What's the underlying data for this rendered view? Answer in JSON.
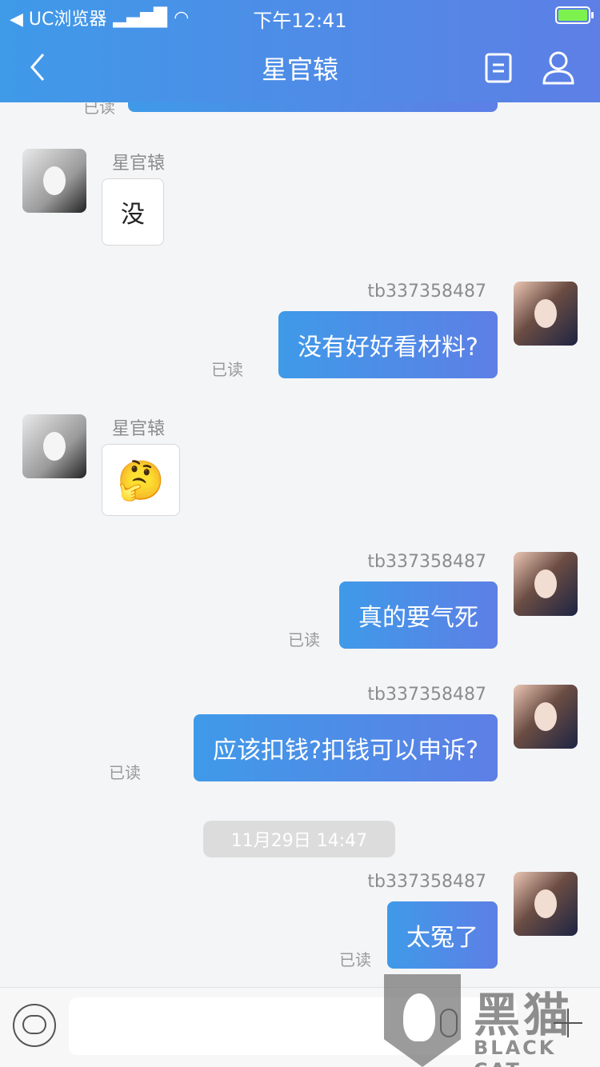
{
  "status_bar": {
    "back_app": "◀ UC浏览器",
    "time": "下午12:41"
  },
  "header": {
    "title": "星官辕"
  },
  "messages": {
    "top_read": "已读",
    "m1": {
      "sender": "星官辕",
      "text": "没"
    },
    "m2": {
      "sender": "tb337358487",
      "text": "没有好好看材料?",
      "read": "已读"
    },
    "m3": {
      "sender": "星官辕",
      "emoji": "🤔"
    },
    "m4": {
      "sender": "tb337358487",
      "text": "真的要气死",
      "read": "已读"
    },
    "m5": {
      "sender": "tb337358487",
      "text": "应该扣钱?扣钱可以申诉?",
      "read": "已读"
    },
    "timestamp": "11月29日 14:47",
    "m6": {
      "sender": "tb337358487",
      "text": "太冤了",
      "read": "已读"
    }
  },
  "watermark": {
    "brand_cn": "黑猫",
    "brand_en": "BLACK CAT"
  }
}
